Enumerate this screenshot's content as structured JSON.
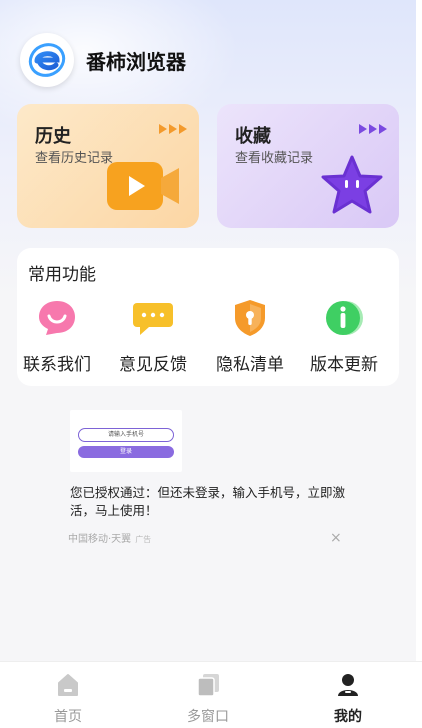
{
  "app": {
    "title": "番柿浏览器"
  },
  "cards": [
    {
      "title": "历史",
      "subtitle": "查看历史记录",
      "icon": "video-play-icon",
      "color": "#fcd6a4"
    },
    {
      "title": "收藏",
      "subtitle": "查看收藏记录",
      "icon": "star-icon",
      "color": "#d9c8f6"
    }
  ],
  "functions": {
    "title": "常用功能",
    "items": [
      {
        "label": "联系我们",
        "icon": "chat-smile-icon",
        "color": "#f76aa0"
      },
      {
        "label": "意见反馈",
        "icon": "message-icon",
        "color": "#f7b829"
      },
      {
        "label": "隐私清单",
        "icon": "shield-lock-icon",
        "color": "#f39a2c"
      },
      {
        "label": "版本更新",
        "icon": "info-icon",
        "color": "#37c45a"
      }
    ]
  },
  "ad": {
    "thumb_input": "请输入手机号",
    "thumb_button": "登录",
    "text": "您已授权通过：但还未登录，输入手机号，立即激活，马上使用！",
    "source": "中国移动·天翼",
    "tag": "广告",
    "close": "×"
  },
  "tabs": [
    {
      "label": "首页",
      "icon": "home-icon"
    },
    {
      "label": "多窗口",
      "icon": "windows-icon"
    },
    {
      "label": "我的",
      "icon": "user-icon",
      "active": true
    }
  ]
}
